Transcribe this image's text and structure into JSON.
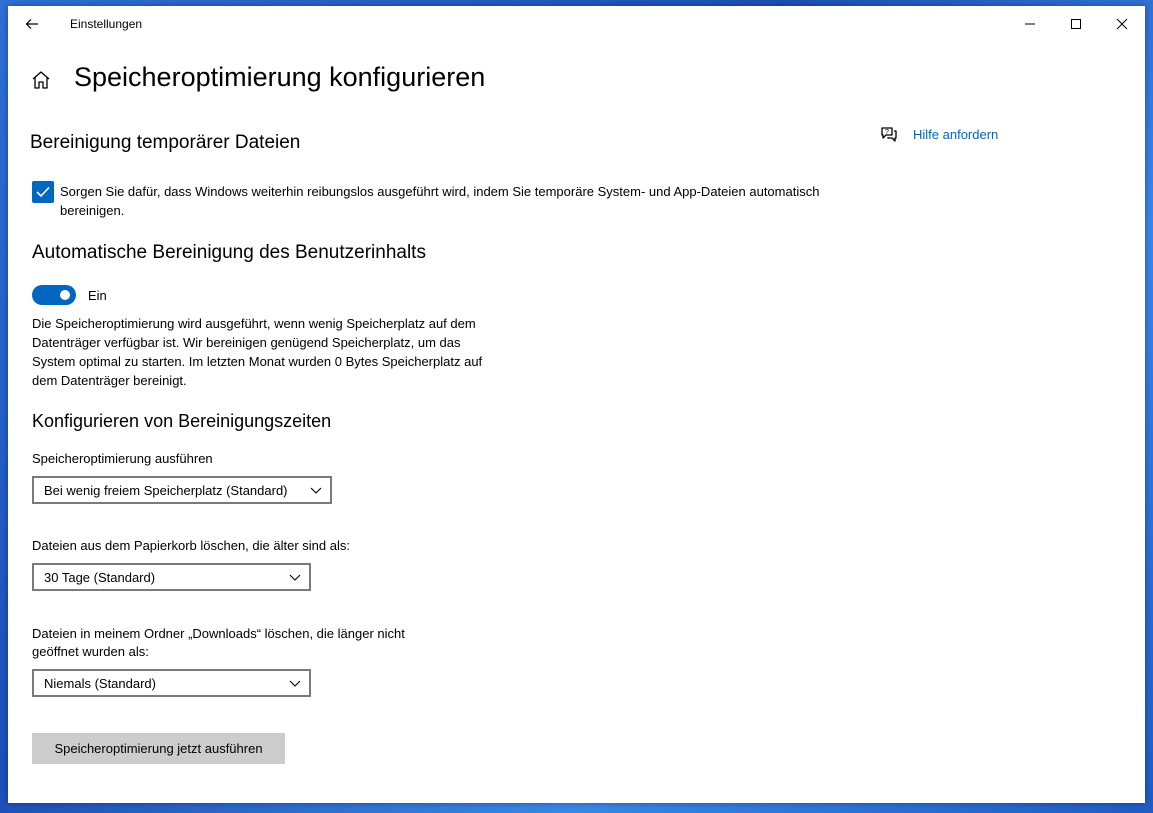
{
  "window": {
    "app_title": "Einstellungen"
  },
  "page": {
    "title": "Speicheroptimierung konfigurieren"
  },
  "temp_files": {
    "section_title": "Bereinigung temporärer Dateien",
    "checkbox_checked": true,
    "checkbox_text": "Sorgen Sie dafür, dass Windows weiterhin reibungslos ausgeführt wird, indem Sie temporäre System- und App-Dateien automatisch bereinigen."
  },
  "auto_cleanup": {
    "section_title": "Automatische Bereinigung des Benutzerinhalts",
    "toggle_on": true,
    "toggle_label": "Ein",
    "description": "Die Speicheroptimierung wird ausgeführt, wenn wenig Speicherplatz auf dem Datenträger verfügbar ist. Wir bereinigen genügend Speicherplatz, um das System optimal zu starten. Im letzten Monat wurden 0 Bytes Speicherplatz auf dem Datenträger bereinigt."
  },
  "schedule": {
    "section_title": "Konfigurieren von Bereinigungszeiten",
    "run_label": "Speicheroptimierung ausführen",
    "run_value": "Bei wenig freiem Speicherplatz (Standard)",
    "recycle_label": "Dateien aus dem Papierkorb löschen, die älter sind als:",
    "recycle_value": "30 Tage (Standard)",
    "downloads_label": "Dateien in meinem Ordner „Downloads“ löschen, die länger nicht geöffnet wurden als:",
    "downloads_value": "Niemals (Standard)"
  },
  "actions": {
    "run_now": "Speicheroptimierung jetzt ausführen"
  },
  "help": {
    "label": "Hilfe anfordern"
  },
  "colors": {
    "accent": "#0067c0",
    "button_bg": "#cccccc"
  }
}
